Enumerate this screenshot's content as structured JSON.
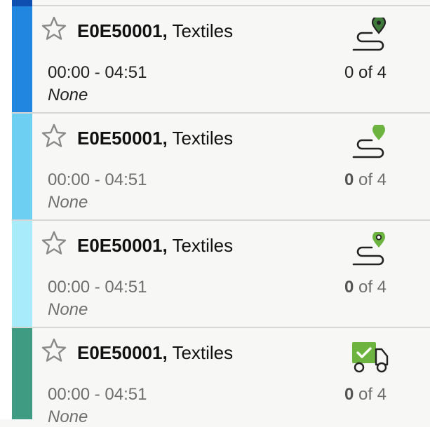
{
  "rows": [
    {
      "code": "E0E50001,",
      "name": "Textiles",
      "time": "00:00 - 04:51",
      "note": "None",
      "count_num": "0",
      "count_rest": " of 4",
      "stripe_color": "#2186df",
      "icon": "route-icon",
      "icon_color": "#3f7a3a"
    },
    {
      "code": "E0E50001,",
      "name": "Textiles",
      "time": "00:00 - 04:51",
      "note": "None",
      "count_num": "0",
      "count_rest": " of 4",
      "stripe_color": "#6dd0f3",
      "icon": "route-icon",
      "icon_color": "#6db33f"
    },
    {
      "code": "E0E50001,",
      "name": "Textiles",
      "time": "00:00 - 04:51",
      "note": "None",
      "count_num": "0",
      "count_rest": " of 4",
      "stripe_color": "#a8ecfb",
      "icon": "route-icon",
      "icon_color": "#6db33f"
    },
    {
      "code": "E0E50001,",
      "name": "Textiles",
      "time": "00:00 - 04:51",
      "note": "None",
      "count_num": "0",
      "count_rest": " of 4",
      "stripe_color": "#3f9b82",
      "icon": "delivery-truck-check-icon",
      "icon_color": "#6db33f"
    }
  ],
  "colors": {
    "top_stub": "#0f4fb0",
    "divider": "#d6d6d4",
    "background": "#f7f7f5"
  }
}
